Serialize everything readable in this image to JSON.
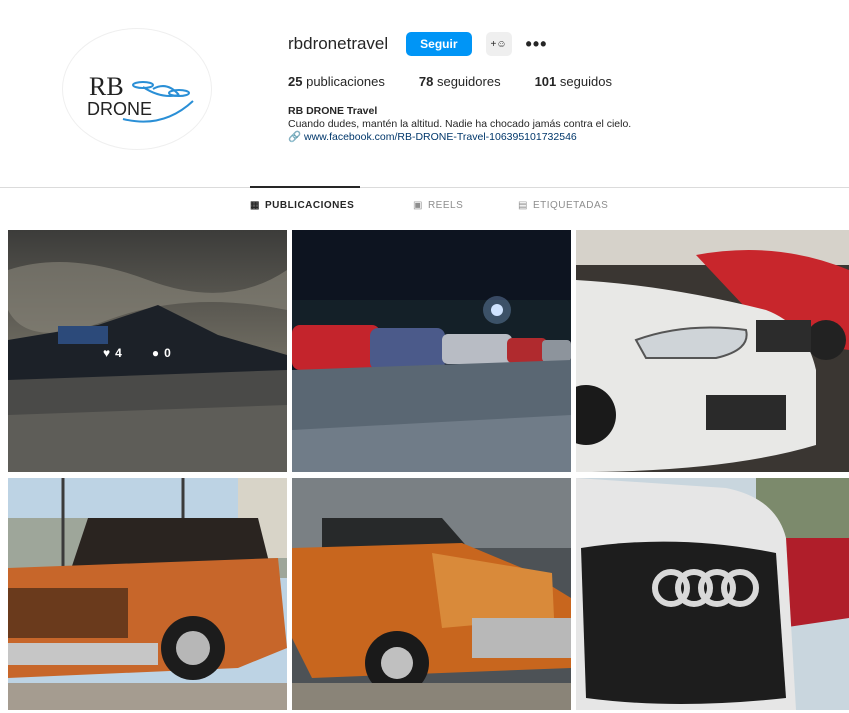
{
  "profile": {
    "username": "rbdronetravel",
    "follow_label": "Seguir",
    "more_label": "•••",
    "avatar_text_line1": "RB",
    "avatar_text_line2": "DRONE"
  },
  "stats": {
    "posts_count": "25",
    "posts_label": "publicaciones",
    "followers_count": "78",
    "followers_label": "seguidores",
    "following_count": "101",
    "following_label": "seguidos"
  },
  "bio": {
    "name": "RB DRONE Travel",
    "text": "Cuando dudes, mantén la altitud. Nadie ha chocado jamás contra el cielo.",
    "link": "www.facebook.com/RB-DRONE-Travel-106395101732546"
  },
  "tabs": [
    {
      "label": "PUBLICACIONES",
      "icon": "grid-icon"
    },
    {
      "label": "REELS",
      "icon": "reels-icon"
    },
    {
      "label": "ETIQUETADAS",
      "icon": "tagged-icon"
    }
  ],
  "posts": [
    {
      "description": "mountain-landscape-truck",
      "likes": "4",
      "comments": "0"
    },
    {
      "description": "night-parking-cars"
    },
    {
      "description": "white-car-headlight"
    },
    {
      "description": "orange-pickup-truck"
    },
    {
      "description": "orange-classic-pickup"
    },
    {
      "description": "audi-grille"
    }
  ],
  "colors": {
    "accent": "#0095f6",
    "text": "#262626",
    "muted": "#8e8e8e",
    "link": "#00376b"
  }
}
